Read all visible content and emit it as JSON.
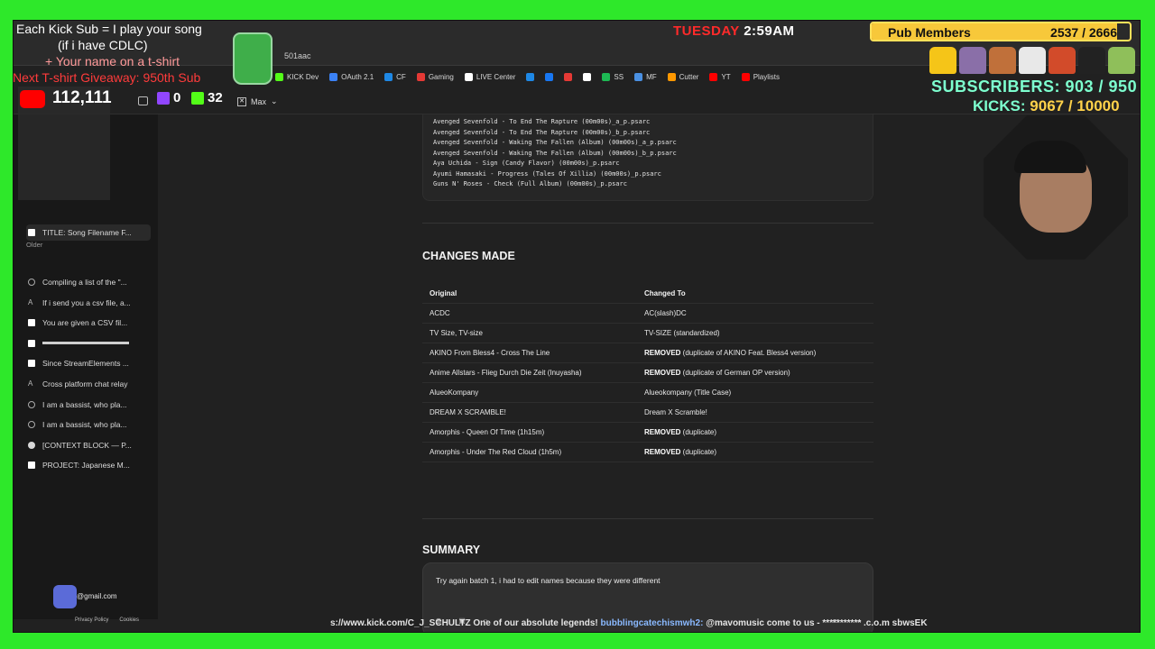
{
  "browser": {
    "url_fragment": "501aac",
    "bookmarks": [
      {
        "label": "KICK Dev",
        "color": "#53fc18"
      },
      {
        "label": "OAuth 2.1",
        "color": "#3b82f6"
      },
      {
        "label": "CF",
        "color": "#1e88e5"
      },
      {
        "label": "Gaming",
        "color": "#e53935"
      },
      {
        "label": "LIVE Center",
        "color": "#ffffff"
      },
      {
        "label": "",
        "color": "#1e88e5"
      },
      {
        "label": "",
        "color": "#1877f2"
      },
      {
        "label": "",
        "color": "#e53935"
      },
      {
        "label": "",
        "color": "#ffffff"
      },
      {
        "label": "SS",
        "color": "#1db954"
      },
      {
        "label": "MF",
        "color": "#4a90e2"
      },
      {
        "label": "Cutter",
        "color": "#ff9800"
      },
      {
        "label": "YT",
        "color": "#ff0000"
      },
      {
        "label": "Playlists",
        "color": "#ff0000"
      }
    ]
  },
  "app": {
    "model_label": "Max",
    "sidebar": {
      "items_recent": [
        {
          "label": "TITLE: Song Filename F...",
          "icon": "claude-icon",
          "active": true
        }
      ],
      "older_label": "Older",
      "items_older": [
        {
          "label": "Compiling a list of the \"...",
          "icon": "globe-icon"
        },
        {
          "label": "If i send you a csv file, a...",
          "icon": "a-icon"
        },
        {
          "label": "You are given a CSV fil...",
          "icon": "claude-icon"
        },
        {
          "label": "",
          "icon": "claude-icon"
        },
        {
          "label": "Since StreamElements ...",
          "icon": "claude-icon"
        },
        {
          "label": "Cross platform chat relay",
          "icon": "a-icon"
        },
        {
          "label": "I am a bassist, who pla...",
          "icon": "globe-icon"
        },
        {
          "label": "I am a bassist, who pla...",
          "icon": "globe-icon"
        },
        {
          "label": "[CONTEXT BLOCK — P...",
          "icon": "g-icon"
        },
        {
          "label": "PROJECT: Japanese M...",
          "icon": "claude-icon"
        }
      ],
      "account_email": "@gmail.com",
      "footer_links": [
        "Privacy Policy",
        "Cookies"
      ]
    },
    "code_lines": [
      "Avenged Sevenfold - To End The Rapture (00m00s)_a_p.psarc",
      "Avenged Sevenfold - To End The Rapture (00m00s)_b_p.psarc",
      "Avenged Sevenfold - Waking The Fallen (Album) (00m00s)_a_p.psarc",
      "Avenged Sevenfold - Waking The Fallen (Album) (00m00s)_b_p.psarc",
      "Aya Uchida - Sign (Candy Flavor) (00m00s)_p.psarc",
      "Ayumi Hamasaki - Progress (Tales Of Xillia) (00m00s)_p.psarc",
      "Guns N' Roses - Check (Full Album) (00m00s)_p.psarc"
    ],
    "changes_title": "CHANGES MADE",
    "table": {
      "headers": [
        "Original",
        "Changed To"
      ],
      "rows": [
        {
          "original": "ACDC",
          "bold": "",
          "rest": "AC(slash)DC"
        },
        {
          "original": "TV Size, TV-size",
          "bold": "",
          "rest": "TV-SIZE (standardized)"
        },
        {
          "original": "AKINO From Bless4 - Cross The Line",
          "bold": "REMOVED",
          "rest": " (duplicate of AKINO Feat. Bless4 version)"
        },
        {
          "original": "Anime Allstars - Flieg Durch Die Zeit (Inuyasha)",
          "bold": "REMOVED",
          "rest": " (duplicate of German OP version)"
        },
        {
          "original": "AlueoKompany",
          "bold": "",
          "rest": "Alueokompany (Title Case)"
        },
        {
          "original": "DREAM X SCRAMBLE!",
          "bold": "",
          "rest": "Dream X Scramble!"
        },
        {
          "original": "Amorphis - Queen Of Time (1h15m)",
          "bold": "REMOVED",
          "rest": " (duplicate)"
        },
        {
          "original": "Amorphis - Under The Red Cloud (1h5m)",
          "bold": "REMOVED",
          "rest": " (duplicate)"
        }
      ]
    },
    "summary_title": "SUMMARY",
    "composer_text": "Try again batch 1, i had to edit names because they were different"
  },
  "overlay": {
    "line1": "Each Kick Sub = I play your song",
    "line2": "(if i have CDLC)",
    "line3": "+ Your name on a t-shirt",
    "line4": "Next T-shirt Giveaway: 950th Sub",
    "yt_count": "112,111",
    "twitch_count": "0",
    "kick_count": "32",
    "clock_day": "TUESDAY",
    "clock_time": "2:59AM",
    "pub_label": "Pub Members",
    "pub_count": "2537 / 2666",
    "pub_progress": 0.95,
    "subs_text": "SUBSCRIBERS: 903 / 950",
    "kicks_label": "KICKS:",
    "kicks_value": "9067 / 10000",
    "shirt_colors": [
      "#f5c518",
      "#8a6fa8",
      "#c0703a",
      "#e8e8e8",
      "#d24b2a",
      "#222222",
      "#8fbf5a"
    ],
    "ticker_left": "s://www.kick.com/C_J_SCHULTZ One of our absolute legends!",
    "ticker_user": "bubblingcatechismwh2:",
    "ticker_right": " @mavomusic come to us - *********** .c.o.m sbwsEK"
  }
}
